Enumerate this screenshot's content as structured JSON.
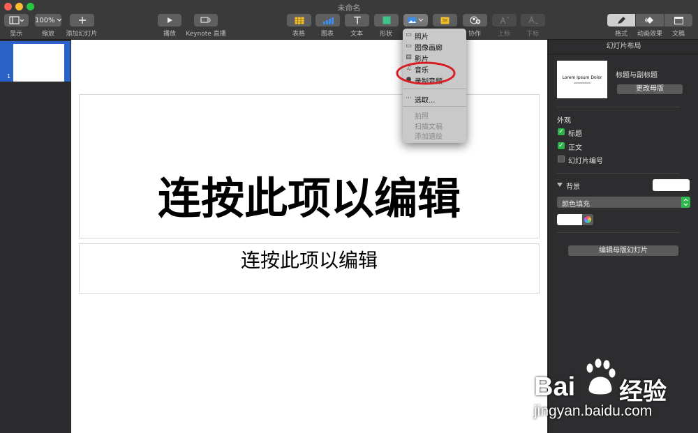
{
  "window": {
    "title": "未命名"
  },
  "toolbar": {
    "view_label": "显示",
    "zoom_value": "100%",
    "zoom_label": "缩放",
    "add_slide_label": "添加幻灯片",
    "play_label": "播放",
    "live_label": "Keynote 直播",
    "table_label": "表格",
    "chart_label": "图表",
    "text_label": "文本",
    "shape_label": "形状",
    "collab_label": "协作",
    "superscript_label": "上标",
    "subscript_label": "下标",
    "format_label": "格式",
    "animate_label": "动画效果",
    "document_label": "文稿"
  },
  "slide_navigator": {
    "slide_number": "1"
  },
  "slide": {
    "title_placeholder": "连按此项以编辑",
    "body_placeholder": "连按此项以编辑"
  },
  "media_menu": {
    "items": [
      {
        "label": "照片",
        "icon": "photo-icon",
        "enabled": true
      },
      {
        "label": "图像画廊",
        "icon": "gallery-icon",
        "enabled": true
      },
      {
        "label": "影片",
        "icon": "film-icon",
        "enabled": true
      },
      {
        "label": "音乐",
        "icon": "music-icon",
        "enabled": true
      },
      {
        "label": "录制音频",
        "icon": "microphone-icon",
        "enabled": true
      },
      {
        "label": "选取...",
        "icon": "choose-icon",
        "enabled": true
      },
      {
        "label": "拍照",
        "enabled": false
      },
      {
        "label": "扫描文稿",
        "enabled": false
      },
      {
        "label": "添加速绘",
        "enabled": false
      }
    ]
  },
  "inspector": {
    "header": "幻灯片布局",
    "layout_preview": "Lorem Ipsum Dolor",
    "layout_name": "标题与副标题",
    "change_master_label": "更改母版",
    "appearance_label": "外观",
    "checkboxes": [
      {
        "label": "标题",
        "checked": true
      },
      {
        "label": "正文",
        "checked": true
      },
      {
        "label": "幻灯片编号",
        "checked": false
      }
    ],
    "background_label": "背景",
    "fill_select_value": "颜色填充",
    "edit_master_label": "编辑母版幻灯片"
  },
  "watermark": {
    "brand": "Bai",
    "brand2": "经验",
    "url": "jingyan.baidu.com"
  },
  "colors": {
    "selection_blue": "#2a62c8",
    "annotation_red": "#d81f26",
    "checkbox_green": "#2db34a",
    "toolbar_bg": "#3a3a3a",
    "menu_bg": "#c9c9c9"
  }
}
